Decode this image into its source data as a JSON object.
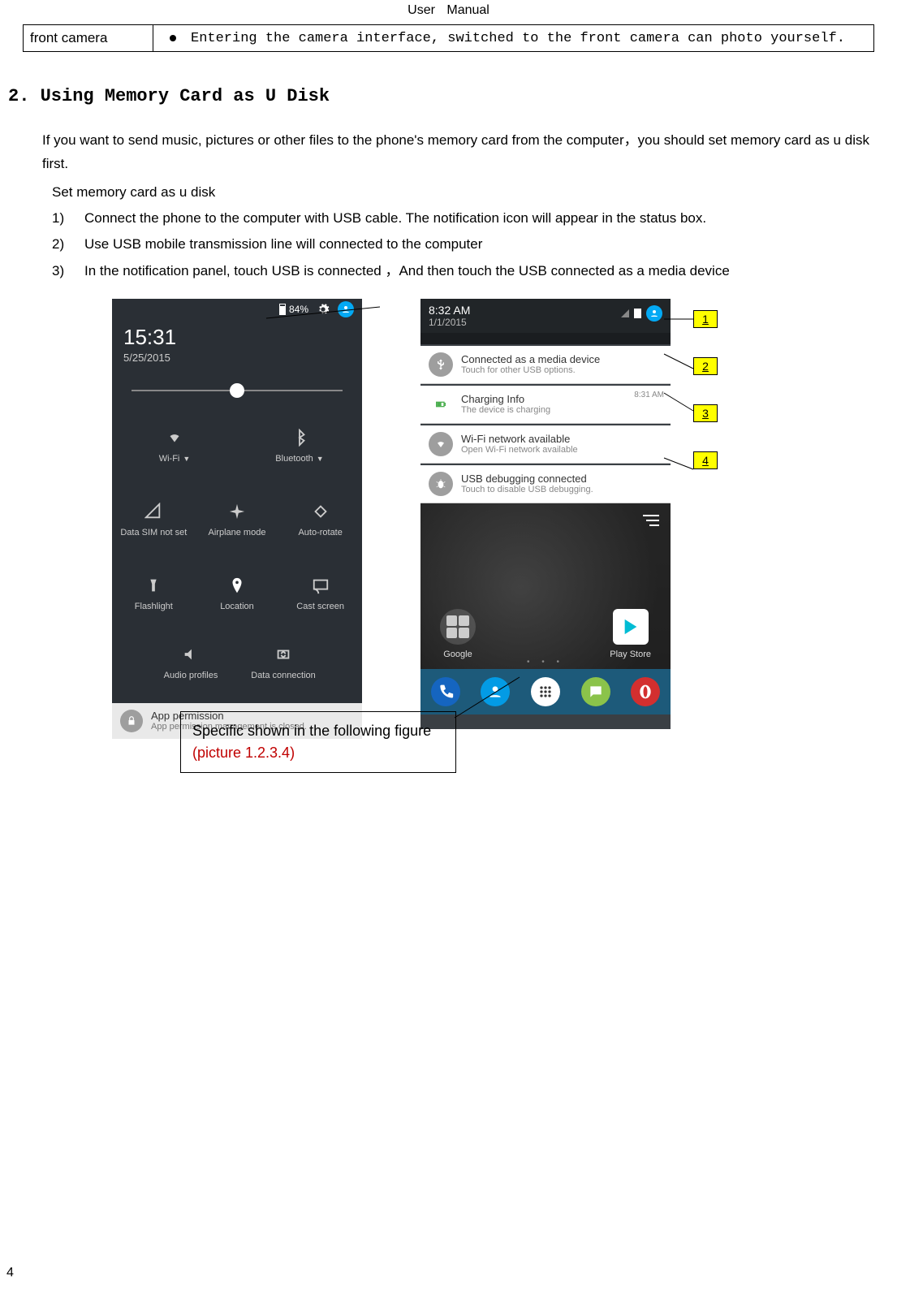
{
  "header": "User  Manual",
  "top_table": {
    "left": "front camera",
    "right": "Entering the camera interface, switched to the front camera can photo yourself."
  },
  "section_heading": "2. Using Memory Card as U Disk",
  "intro": "If you want to send music, pictures or other files to the phone's memory card from the computer，you should set memory card as u disk first.",
  "sub_intro": "Set memory card as u disk",
  "steps": [
    {
      "num": "1)",
      "text": "Connect the phone to the computer with USB cable. The notification icon will appear in the status box."
    },
    {
      "num": "2)",
      "text": "Use USB mobile transmission line will connected to the computer"
    },
    {
      "num": "3)",
      "text": "In the notification panel, touch USB is connected  ，And then touch the USB connected as a media device"
    }
  ],
  "phone1": {
    "battery": "84%",
    "time": "15:31",
    "date": "5/25/2015",
    "tiles": {
      "wifi": "Wi-Fi",
      "bluetooth": "Bluetooth",
      "data": "Data SIM not set",
      "airplane": "Airplane mode",
      "rotate": "Auto-rotate",
      "flash": "Flashlight",
      "location": "Location",
      "cast": "Cast screen",
      "audio": "Audio profiles",
      "dataconn": "Data connection"
    },
    "notif": {
      "title": "App permission",
      "sub": "App permission management is closed."
    }
  },
  "phone2": {
    "time": "8:32 AM",
    "date": "1/1/2015",
    "notifs": [
      {
        "title": "Connected as a media device",
        "sub": "Touch for other USB options.",
        "time": ""
      },
      {
        "title": "Charging Info",
        "sub": "The device is charging",
        "time": "8:31 AM"
      },
      {
        "title": "Wi-Fi network available",
        "sub": "Open Wi-Fi network available",
        "time": ""
      },
      {
        "title": "USB debugging connected",
        "sub": "Touch to disable USB debugging.",
        "time": ""
      }
    ],
    "home": {
      "google": "Google",
      "play": "Play Store"
    }
  },
  "callouts": [
    "1",
    "2",
    "3",
    "4"
  ],
  "caption": {
    "text": "Specific shown in the following figure  ",
    "red": "(picture 1.2.3.4)"
  },
  "page_number": "4"
}
